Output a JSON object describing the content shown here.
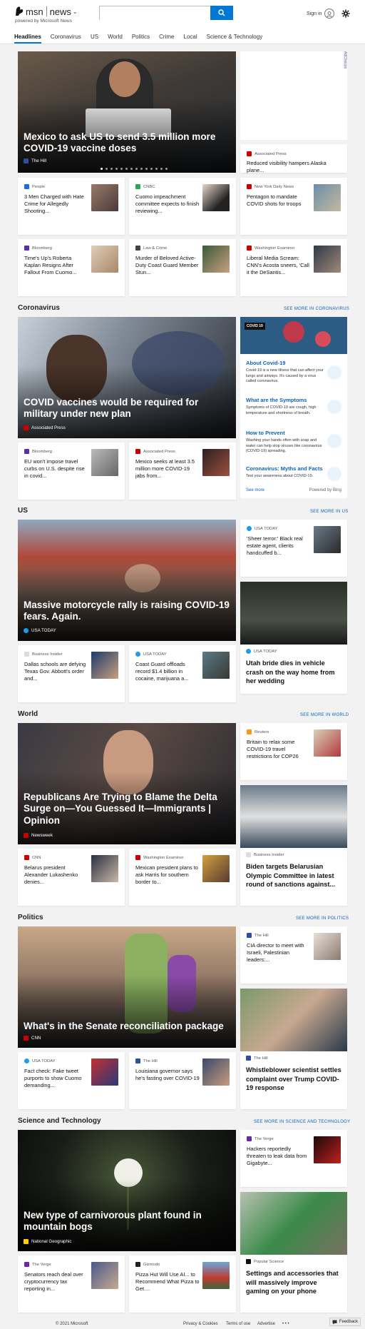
{
  "header": {
    "logo": "msn",
    "product": "news",
    "powered": "powered by Microsoft News",
    "search_value": "",
    "sign_in": "Sign in"
  },
  "nav": [
    "Headlines",
    "Coronavirus",
    "US",
    "World",
    "Politics",
    "Crime",
    "Local",
    "Science & Technology"
  ],
  "top": {
    "hero": {
      "title": "Mexico to ask US to send 3.5 million more COVID-19 vaccine doses",
      "source": "The Hill"
    },
    "ad": {
      "label": "AdChoices"
    },
    "side": {
      "source": "Associated Press",
      "title": "Reduced visibility hampers Alaska plane..."
    },
    "cards": [
      {
        "source": "People",
        "title": "3 Men Charged with Hate Crime for Allegedly Shooting..."
      },
      {
        "source": "CNBC",
        "title": "Cuomo impeachment committee expects to finish reviewing..."
      },
      {
        "source": "New York Daily News",
        "title": "Pentagon to mandate COVID shots for troops"
      },
      {
        "source": "Bloomberg",
        "title": "Time's Up's Roberta Kaplan Resigns After Fallout From Cuomo..."
      },
      {
        "source": "Law & Crime",
        "title": "Murder of Beloved Active-Duty Coast Guard Member Stun..."
      },
      {
        "source": "Washington Examiner",
        "title": "Liberal Media Scream: CNN's Acosta sneers, 'Call it the DeSantis..."
      }
    ]
  },
  "coronavirus": {
    "heading": "Coronavirus",
    "more": "SEE MORE IN CORONAVIRUS",
    "hero": {
      "title": "COVID vaccines would be required for military under new plan",
      "source": "Associated Press"
    },
    "cards": [
      {
        "source": "Bloomberg",
        "title": "EU won't impose travel curbs on U.S. despite rise in covid..."
      },
      {
        "source": "Associated Press",
        "title": "Mexico seeks at least 3.5 million more COVID-19 jabs from..."
      }
    ],
    "panel": {
      "badge": "COVID 19",
      "items": [
        {
          "title": "About Covid-19",
          "body": "Covid-19 is a new illness that can affect your lungs and airways. It's caused by a virus called coronavirus."
        },
        {
          "title": "What are the Symptoms",
          "body": "Symptoms of COVID-19 are cough, high temperature and shortness of breath."
        },
        {
          "title": "How to Prevent",
          "body": "Washing your hands often with soap and water can help stop viruses like coronavirus (COVID-19) spreading."
        },
        {
          "title": "Coronavirus: Myths and Facts",
          "body": "Test your awareness about COVID-19."
        }
      ],
      "see_more": "See more",
      "powered": "Powered by Bing"
    }
  },
  "us": {
    "heading": "US",
    "more": "SEE MORE IN US",
    "hero": {
      "title": "Massive motorcycle rally is raising COVID-19 fears. Again.",
      "source": "USA TODAY"
    },
    "side": {
      "source": "USA TODAY",
      "title": "'Sheer terror:' Black real estate agent, clients handcuffed b..."
    },
    "tall": {
      "source": "USA TODAY",
      "title": "Utah bride dies in vehicle crash on the way home from her wedding"
    },
    "cards": [
      {
        "source": "Business Insider",
        "title": "Dallas schools are defying Texas Gov. Abbott's order and..."
      },
      {
        "source": "USA TODAY",
        "title": "Coast Guard offloads record $1.4 billion in cocaine, marijuana a..."
      }
    ]
  },
  "world": {
    "heading": "World",
    "more": "SEE MORE IN WORLD",
    "hero": {
      "title": "Republicans Are Trying to Blame the Delta Surge on—You Guessed It—Immigrants | Opinion",
      "source": "Newsweek"
    },
    "side": {
      "source": "Reuters",
      "title": "Britain to relax some COVID-19 travel restrictions for COP26"
    },
    "tall": {
      "source": "Business Insider",
      "title": "Biden targets Belarusian Olympic Committee in latest round of sanctions against..."
    },
    "cards": [
      {
        "source": "CNN",
        "title": "Belarus president Alexander Lukashenko denies..."
      },
      {
        "source": "Washington Examiner",
        "title": "Mexican president plans to ask Harris for southern border to..."
      }
    ]
  },
  "politics": {
    "heading": "Politics",
    "more": "SEE MORE IN POLITICS",
    "hero": {
      "title": "What's in the Senate reconciliation package",
      "source": "CNN"
    },
    "side": {
      "source": "The Hill",
      "title": "CIA director to meet with Israeli, Palestinian leaders:..."
    },
    "tall": {
      "source": "The Hill",
      "title": "Whistleblower scientist settles complaint over Trump COVID-19 response"
    },
    "cards": [
      {
        "source": "USA TODAY",
        "title": "Fact check: Fake tweet purports to show Cuomo demanding..."
      },
      {
        "source": "The Hill",
        "title": "Louisiana governor says he's fasting over COVID-19"
      }
    ]
  },
  "scitech": {
    "heading": "Science and Technology",
    "more": "SEE MORE IN SCIENCE AND TECHNOLOGY",
    "hero": {
      "title": "New type of carnivorous plant found in mountain bogs",
      "source": "National Geographic"
    },
    "side": {
      "source": "The Verge",
      "title": "Hackers reportedly threaten to leak data from Gigabyte..."
    },
    "tall": {
      "source": "Popular Science",
      "title": "Settings and accessories that will massively improve gaming on your phone"
    },
    "cards": [
      {
        "source": "The Verge",
        "title": "Senators reach deal over cryptocurrency tax reporting in..."
      },
      {
        "source": "Gizmodo",
        "title": "Pizza Hut Will Use AI... to Recommend What Pizza to Get...."
      }
    ]
  },
  "footer": {
    "copyright": "© 2021 Microsoft",
    "privacy": "Privacy & Cookies",
    "terms": "Terms of use",
    "advertise": "Advertise",
    "more": "• • •",
    "feedback": "Feedback"
  }
}
